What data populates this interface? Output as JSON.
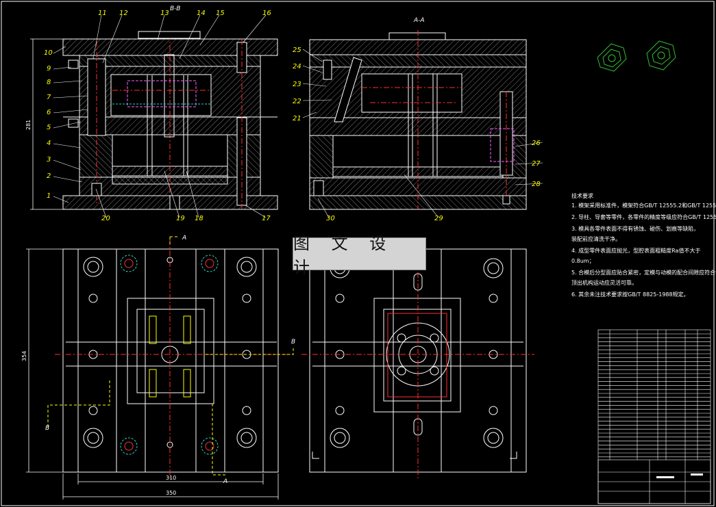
{
  "sections": {
    "bb": "B-B",
    "aa": "A-A"
  },
  "part_numbers": [
    "1",
    "2",
    "3",
    "4",
    "5",
    "6",
    "7",
    "8",
    "9",
    "10",
    "11",
    "12",
    "13",
    "14",
    "15",
    "16",
    "17",
    "18",
    "19",
    "20",
    "21",
    "22",
    "23",
    "24",
    "25",
    "26",
    "27",
    "28",
    "29",
    "30"
  ],
  "dimensions": {
    "height_281": "281",
    "height_354": "354",
    "width_310": "310",
    "width_350": "350"
  },
  "cut_labels": {
    "a": "A",
    "b": "B"
  },
  "watermark": "图 文 设 计",
  "tech_requirements": {
    "title": "技术要求",
    "items": [
      "1. 模架采用标准件，模架符合GB/T 12555.2和GB/T 12556.2规范。",
      "2. 导柱、导套等零件，各零件的精度等级应符合GB/T 12555.2和GB/T 12556.2；",
      "3. 模具各零件表面不得有锈蚀、碰伤、划痕等缺陷，",
      "   装配前应清洗干净。",
      "4. 成型零件表面应抛光，型腔表面粗糙度Ra值不大于",
      "   0.8um；",
      "5. 合模后分型面应贴合紧密，定模与动模的配合间隙应符合设计要求，",
      "   顶出机构运动应灵活可靠。",
      "6. 其余未注技术要求按GB/T 8825-1988规定。"
    ]
  },
  "colors": {
    "background": "#000000",
    "line": "#ffffff",
    "label": "#ffff00",
    "center": "#ff3030",
    "hatch": "#b0b0b0",
    "hidden": "#ff60ff",
    "cyan": "#30d0d0",
    "green": "#30c030"
  }
}
